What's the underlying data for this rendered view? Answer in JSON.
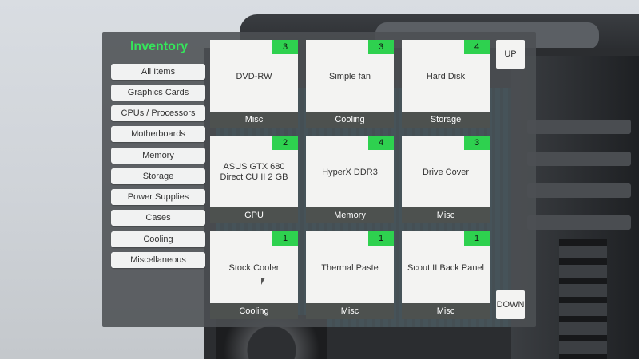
{
  "inventory": {
    "title": "Inventory",
    "categories": [
      "All Items",
      "Graphics Cards",
      "CPUs / Processors",
      "Motherboards",
      "Memory",
      "Storage",
      "Power Supplies",
      "Cases",
      "Cooling",
      "Miscellaneous"
    ],
    "items": [
      {
        "name": "DVD-RW",
        "type": "Misc",
        "count": "3"
      },
      {
        "name": "Simple fan",
        "type": "Cooling",
        "count": "3"
      },
      {
        "name": "Hard Disk",
        "type": "Storage",
        "count": "4"
      },
      {
        "name": "ASUS GTX 680 Direct CU II 2 GB",
        "type": "GPU",
        "count": "2"
      },
      {
        "name": "HyperX DDR3",
        "type": "Memory",
        "count": "4"
      },
      {
        "name": "Drive Cover",
        "type": "Misc",
        "count": "3"
      },
      {
        "name": "Stock Cooler",
        "type": "Cooling",
        "count": "1"
      },
      {
        "name": "Thermal Paste",
        "type": "Misc",
        "count": "1"
      },
      {
        "name": "Scout II Back Panel",
        "type": "Misc",
        "count": "1"
      }
    ],
    "scroll_up_label": "UP",
    "scroll_down_label": "DOWN"
  },
  "colors": {
    "accent_green": "#35e55b",
    "count_badge": "#2ed14f",
    "panel_bg": "#4c5053"
  }
}
